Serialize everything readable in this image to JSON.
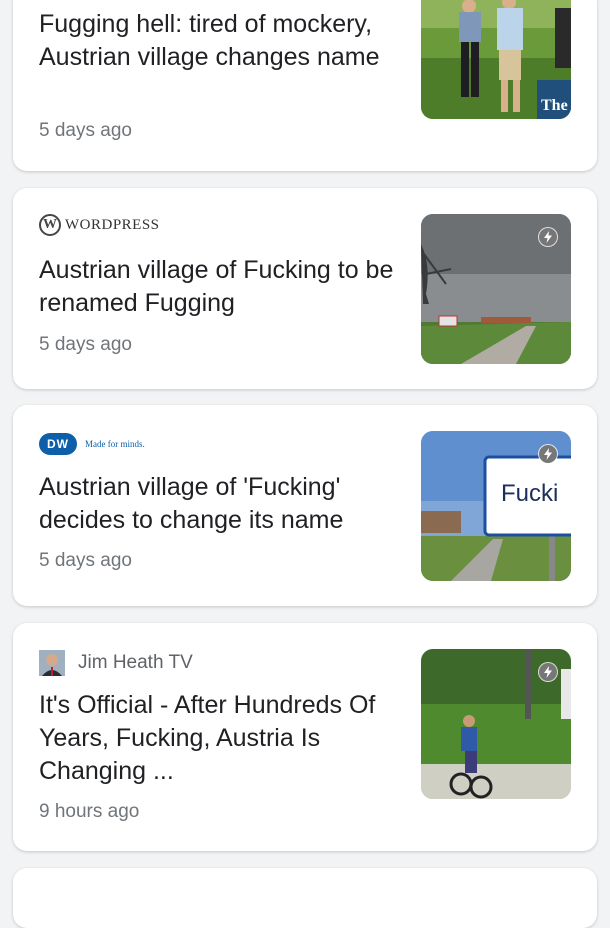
{
  "cards": [
    {
      "title": "Fugging hell: tired of mockery, Austrian village changes name",
      "time": "5 days ago",
      "thumb_badge": "The Gu"
    },
    {
      "source": "WordPress",
      "source_logo_letter": "W",
      "title": "Austrian village of Fucking to be renamed Fugging",
      "time": "5 days ago",
      "thumb_icon": "amp-bolt-icon"
    },
    {
      "source_logo_letters": "DW",
      "source_tagline": "Made for minds.",
      "title": "Austrian village of 'Fucking' decides to change its name",
      "time": "5 days ago",
      "thumb_sign_text": "Fucki",
      "thumb_icon": "amp-bolt-icon"
    },
    {
      "source": "Jim Heath TV",
      "title": "It's Official - After Hundreds Of Years, Fucking, Austria Is Changing ...",
      "time": "9 hours ago",
      "thumb_icon": "amp-bolt-icon"
    }
  ],
  "colors": {
    "background": "#f1f3f4",
    "card": "#ffffff",
    "title": "#202124",
    "meta": "#70757a",
    "dw_blue": "#0c5fa8"
  }
}
